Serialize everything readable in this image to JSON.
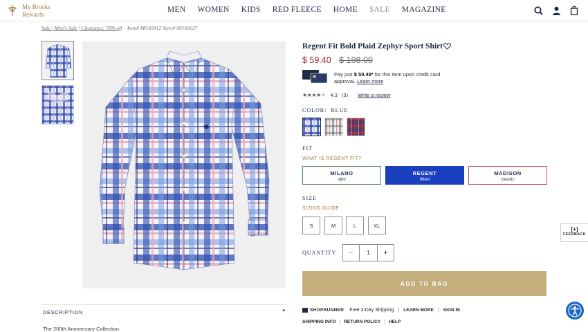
{
  "header": {
    "logo_line1": "My Brooks",
    "logo_line2": "Rewards",
    "nav": [
      "MEN",
      "WOMEN",
      "KIDS",
      "RED FLEECE",
      "HOME",
      "SALE",
      "MAGAZINE"
    ],
    "icons": [
      "search-icon",
      "account-icon",
      "bag-icon"
    ]
  },
  "breadcrumb": {
    "path": "Sale | Men's Sale | Clearance: 70% off",
    "item": "Item# MG02812 Style# 00102627"
  },
  "product": {
    "title": "Regent Fit Bold Plaid Zephyr Sport Shirt",
    "price_now": "$ 59.40",
    "price_was": "$ 198.00",
    "pay_prefix": "Pay just ",
    "pay_amount": "$ 50.49*",
    "pay_suffix": " for this item upon credit card approval. ",
    "pay_link": "Learn more",
    "rating_value": "4.3",
    "rating_count": "(3)",
    "rating_stars": 4.3,
    "write_review": "Write a review"
  },
  "color": {
    "label": "COLOR:",
    "selected": "BLUE",
    "swatches": [
      {
        "name": "blue",
        "accent": "#2c4aa0"
      },
      {
        "name": "grey",
        "accent": "#9aa0a6"
      },
      {
        "name": "red",
        "accent": "#a3232c"
      }
    ]
  },
  "fit": {
    "label": "FIT",
    "help": "WHAT IS REGENT FIT?",
    "options": [
      {
        "name": "MILANO",
        "sub": "slim"
      },
      {
        "name": "REGENT",
        "sub": "fitted"
      },
      {
        "name": "MADISON",
        "sub": "classic"
      }
    ],
    "selected": "REGENT"
  },
  "size": {
    "label": "SIZE",
    "guide": "SIZING GUIDE",
    "options": [
      "S",
      "M",
      "L",
      "XL"
    ]
  },
  "quantity": {
    "label": "QUANTITY",
    "minus": "−",
    "value": "1",
    "plus": "+"
  },
  "cta": {
    "add_to_bag": "ADD TO BAG"
  },
  "shipping": {
    "shoprunner": "SHOPRUNNER",
    "free": "Free 2-Day Shipping",
    "learn_more": "LEARN MORE",
    "sign_in": "SIGN IN",
    "shipping_info": "SHIPPING INFO",
    "return_policy": "RETURN POLICY",
    "help": "HELP"
  },
  "description": {
    "label": "DESCRIPTION",
    "caret": "▾",
    "teaser": "The 200th Anniversary Collection"
  },
  "feedback": {
    "plus": "[+]",
    "label": "FEEDBACK"
  },
  "colors": {
    "navy": "#1f2a44",
    "gold": "#c3ae7c",
    "sale_red": "#a3232c",
    "fit_selected": "#1a3fbf"
  }
}
